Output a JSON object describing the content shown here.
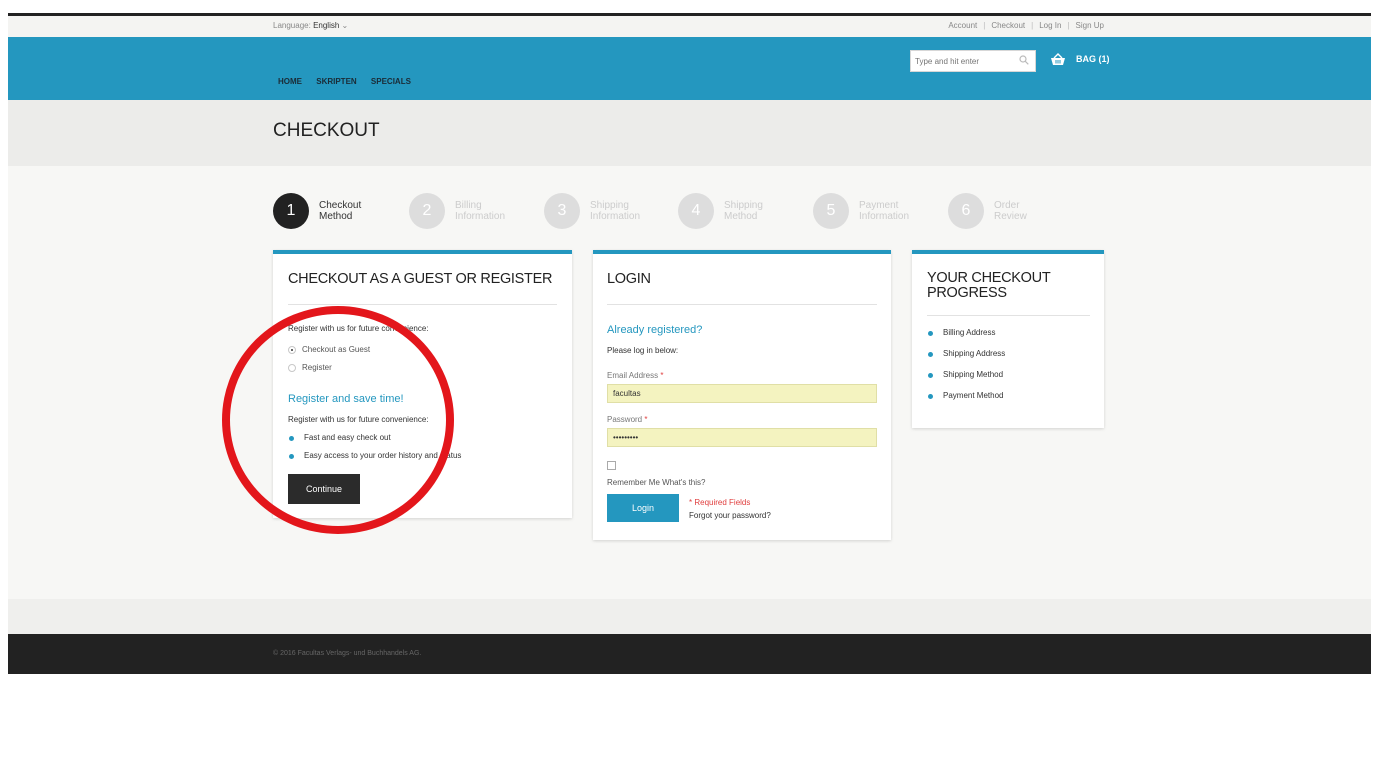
{
  "header": {
    "language_label": "Language:",
    "language_value": "English",
    "links": [
      "Account",
      "Checkout",
      "Log In",
      "Sign Up"
    ],
    "search_placeholder": "Type and hit enter",
    "bag_label": "BAG (1)",
    "nav": [
      "HOME",
      "SKRIPTEN",
      "SPECIALS"
    ]
  },
  "page_title": "CHECKOUT",
  "steps": [
    {
      "num": "1",
      "line1": "Checkout",
      "line2": "Method",
      "active": true
    },
    {
      "num": "2",
      "line1": "Billing",
      "line2": "Information",
      "active": false
    },
    {
      "num": "3",
      "line1": "Shipping",
      "line2": "Information",
      "active": false
    },
    {
      "num": "4",
      "line1": "Shipping",
      "line2": "Method",
      "active": false
    },
    {
      "num": "5",
      "line1": "Payment",
      "line2": "Information",
      "active": false
    },
    {
      "num": "6",
      "line1": "Order",
      "line2": "Review",
      "active": false
    }
  ],
  "guest_panel": {
    "title": "CHECKOUT AS A GUEST OR REGISTER",
    "intro": "Register with us for future convenience:",
    "options": [
      "Checkout as Guest",
      "Register"
    ],
    "selected_option": "Checkout as Guest",
    "save_title": "Register and save time!",
    "save_intro": "Register with us for future convenience:",
    "benefits": [
      "Fast and easy check out",
      "Easy access to your order history and status"
    ],
    "continue_label": "Continue"
  },
  "login_panel": {
    "title": "LOGIN",
    "subtitle": "Already registered?",
    "prompt": "Please log in below:",
    "email_label": "Email Address",
    "email_value": "facultas",
    "password_label": "Password",
    "password_value": "•••••••••",
    "required_mark": "*",
    "remember_label": "Remember Me",
    "whats_this": "What's this?",
    "login_label": "Login",
    "required_fields": "* Required Fields",
    "forgot": "Forgot your password?"
  },
  "progress_panel": {
    "title_line1": "YOUR CHECKOUT",
    "title_line2": "PROGRESS",
    "items": [
      "Billing Address",
      "Shipping Address",
      "Shipping Method",
      "Payment Method"
    ]
  },
  "footer": {
    "copyright": "© 2016 Facultas Verlags- und Buchhandels AG."
  },
  "colors": {
    "accent": "#2497bf",
    "dark": "#222222",
    "annotation": "#e3161b",
    "field_bg": "#f4f3c0"
  }
}
